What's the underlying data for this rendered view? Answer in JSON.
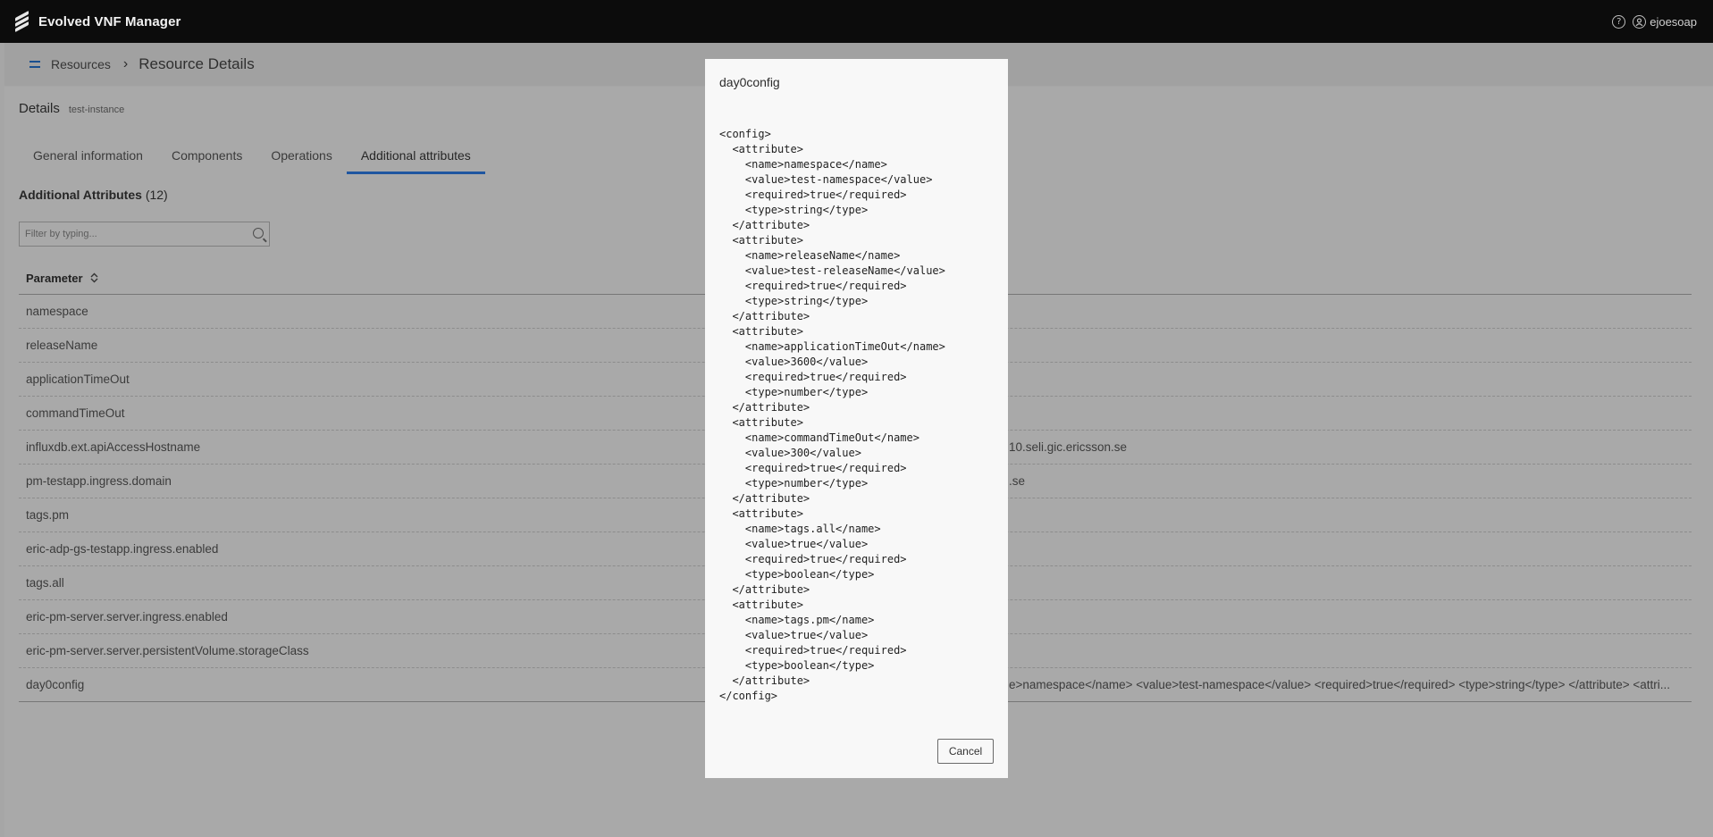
{
  "app": {
    "title": "Evolved VNF Manager"
  },
  "topbar": {
    "help_symbol": "?",
    "user_name": "ejoesoap"
  },
  "breadcrumb": {
    "parent": "Resources",
    "separator": "›",
    "current": "Resource Details"
  },
  "details": {
    "title": "Details",
    "instance": "test-instance"
  },
  "tabs": [
    {
      "label": "General information",
      "active": false
    },
    {
      "label": "Components",
      "active": false
    },
    {
      "label": "Operations",
      "active": false
    },
    {
      "label": "Additional attributes",
      "active": true
    }
  ],
  "attributes": {
    "title": "Additional Attributes",
    "count": "(12)",
    "filter_placeholder": "Filter by typing...",
    "column_header": "Parameter",
    "rows": [
      {
        "param": "namespace",
        "value": ""
      },
      {
        "param": "releaseName",
        "value": ""
      },
      {
        "param": "applicationTimeOut",
        "value": ""
      },
      {
        "param": "commandTimeOut",
        "value": ""
      },
      {
        "param": "influxdb.ext.apiAccessHostname",
        "value": "10.seli.gic.ericsson.se"
      },
      {
        "param": "pm-testapp.ingress.domain",
        "value": ".se"
      },
      {
        "param": "tags.pm",
        "value": ""
      },
      {
        "param": "eric-adp-gs-testapp.ingress.enabled",
        "value": ""
      },
      {
        "param": "tags.all",
        "value": ""
      },
      {
        "param": "eric-pm-server.server.ingress.enabled",
        "value": ""
      },
      {
        "param": "eric-pm-server.server.persistentVolume.storageClass",
        "value": ""
      },
      {
        "param": "day0config",
        "value": "e>namespace</name> <value>test-namespace</value> <required>true</required> <type>string</type> </attribute> <attri..."
      }
    ]
  },
  "dialog": {
    "title": "day0config",
    "content": "<config>\n  <attribute>\n    <name>namespace</name>\n    <value>test-namespace</value>\n    <required>true</required>\n    <type>string</type>\n  </attribute>\n  <attribute>\n    <name>releaseName</name>\n    <value>test-releaseName</value>\n    <required>true</required>\n    <type>string</type>\n  </attribute>\n  <attribute>\n    <name>applicationTimeOut</name>\n    <value>3600</value>\n    <required>true</required>\n    <type>number</type>\n  </attribute>\n  <attribute>\n    <name>commandTimeOut</name>\n    <value>300</value>\n    <required>true</required>\n    <type>number</type>\n  </attribute>\n  <attribute>\n    <name>tags.all</name>\n    <value>true</value>\n    <required>true</required>\n    <type>boolean</type>\n  </attribute>\n  <attribute>\n    <name>tags.pm</name>\n    <value>true</value>\n    <required>true</required>\n    <type>boolean</type>\n  </attribute>\n</config>",
    "cancel_label": "Cancel"
  }
}
